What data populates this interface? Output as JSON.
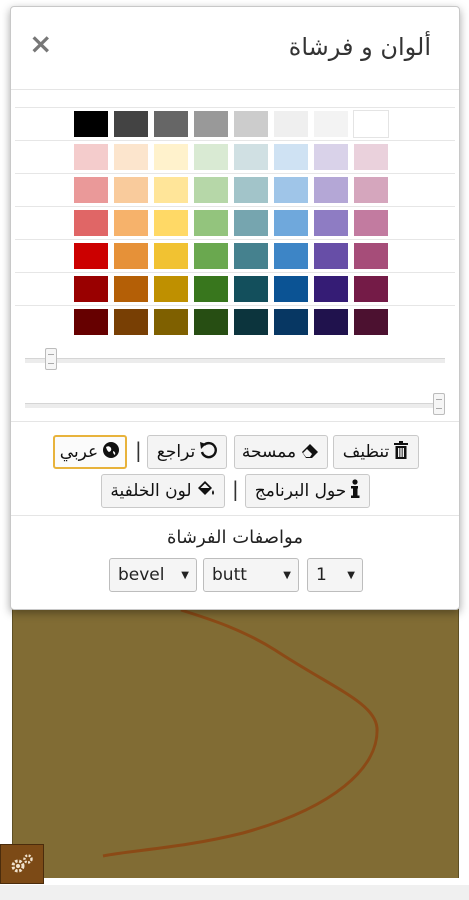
{
  "dialog": {
    "title": "ألوان و فرشاة",
    "close_label": "×"
  },
  "palette": {
    "rows": [
      [
        "#000000",
        "#434343",
        "#666666",
        "#999999",
        "#cccccc",
        "#efefef",
        "#f3f3f3",
        "#ffffff"
      ],
      [
        "#f4cccc",
        "#fce5cd",
        "#fff2cc",
        "#d9ead3",
        "#d0e0e3",
        "#cfe2f3",
        "#d9d2e9",
        "#ead1dc"
      ],
      [
        "#ea9999",
        "#f9cb9c",
        "#ffe599",
        "#b6d7a8",
        "#a2c4c9",
        "#9fc5e8",
        "#b4a7d6",
        "#d5a6bd"
      ],
      [
        "#e06666",
        "#f6b26b",
        "#ffd966",
        "#93c47d",
        "#76a5af",
        "#6fa8dc",
        "#8e7cc3",
        "#c27ba0"
      ],
      [
        "#cc0000",
        "#e69138",
        "#f1c232",
        "#6aa84f",
        "#45818e",
        "#3d85c6",
        "#674ea7",
        "#a64d79"
      ],
      [
        "#990000",
        "#b45f06",
        "#bf9000",
        "#38761d",
        "#134f5c",
        "#0b5394",
        "#351c75",
        "#741b47"
      ],
      [
        "#660000",
        "#783f04",
        "#7f6000",
        "#274e13",
        "#0c343d",
        "#073763",
        "#20124d",
        "#4c1130"
      ]
    ]
  },
  "sliders": {
    "size_value": 0.05,
    "opacity_value": 1.0
  },
  "buttons": {
    "clear": "تنظيف",
    "eraser": "ممسحة",
    "undo": "تراجع",
    "language": "عربي",
    "about": "حول البرنامج",
    "background": "لون الخلفية",
    "separator": "|"
  },
  "brush": {
    "heading": "مواصفات الفرشاة",
    "join": "bevel",
    "cap": "butt",
    "width": "1"
  },
  "canvas": {
    "background": "#816c34",
    "stroke_color": "#8b4a16"
  },
  "icons": {
    "trash": "trash-icon",
    "eraser": "eraser-icon",
    "undo": "undo-icon",
    "language": "globe-icon",
    "info": "info-icon",
    "fill": "paint-bucket-icon",
    "settings": "gears-icon"
  }
}
